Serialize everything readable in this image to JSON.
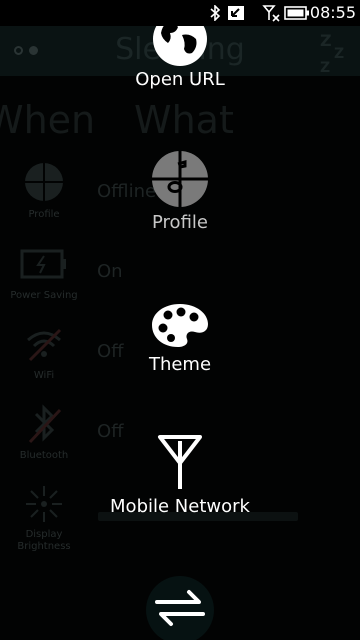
{
  "status_bar": {
    "time": "08:55",
    "icons": [
      "bluetooth-icon",
      "notification-icon",
      "no-signal-icon",
      "battery-icon"
    ]
  },
  "background_app": {
    "title": "Sleeping",
    "column_when": "When",
    "column_what": "What",
    "rows": [
      {
        "label": "Profile",
        "value": "Offline",
        "icon": "profile-icon"
      },
      {
        "label": "Power Saving",
        "value": "On",
        "icon": "power-saving-icon"
      },
      {
        "label": "WiFi",
        "value": "Off",
        "icon": "wifi-icon"
      },
      {
        "label": "Bluetooth",
        "value": "Off",
        "icon": "bluetooth-icon"
      },
      {
        "label": "Display\nBrightness",
        "value": "",
        "icon": "brightness-icon"
      }
    ]
  },
  "menu": {
    "items": [
      {
        "label": "Open URL",
        "icon": "globe-icon"
      },
      {
        "label": "Profile",
        "icon": "profile-icon"
      },
      {
        "label": "Theme",
        "icon": "palette-icon"
      },
      {
        "label": "Mobile Network",
        "icon": "antenna-icon"
      }
    ],
    "toggle_icon": "swap-arrows-icon"
  },
  "colors": {
    "background": "#000000",
    "text": "#ffffff",
    "dimmed_header": "#0a1313"
  }
}
